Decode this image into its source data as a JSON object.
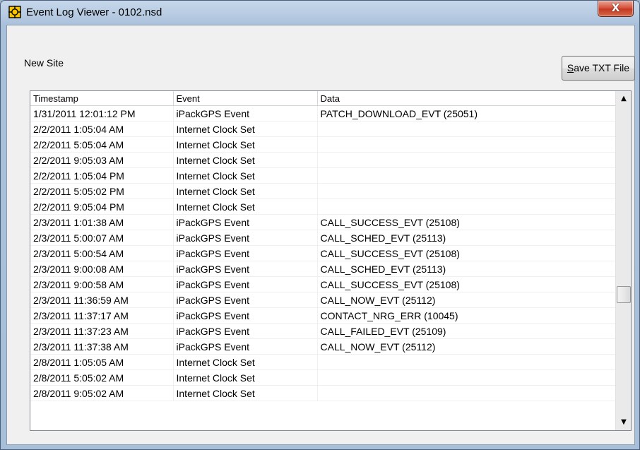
{
  "window": {
    "title": "Event Log Viewer - 0102.nsd",
    "close_label": "X"
  },
  "site_label": "New Site",
  "save_button": {
    "prefix": "S",
    "rest": "ave TXT File"
  },
  "table": {
    "columns": [
      "Timestamp",
      "Event",
      "Data"
    ],
    "rows": [
      [
        "1/31/2011 12:01:12 PM",
        "iPackGPS Event",
        "PATCH_DOWNLOAD_EVT (25051)"
      ],
      [
        "2/2/2011 1:05:04 AM",
        "Internet Clock Set",
        ""
      ],
      [
        "2/2/2011 5:05:04 AM",
        "Internet Clock Set",
        ""
      ],
      [
        "2/2/2011 9:05:03 AM",
        "Internet Clock Set",
        ""
      ],
      [
        "2/2/2011 1:05:04 PM",
        "Internet Clock Set",
        ""
      ],
      [
        "2/2/2011 5:05:02 PM",
        "Internet Clock Set",
        ""
      ],
      [
        "2/2/2011 9:05:04 PM",
        "Internet Clock Set",
        ""
      ],
      [
        "2/3/2011 1:01:38 AM",
        "iPackGPS Event",
        "CALL_SUCCESS_EVT (25108)"
      ],
      [
        "2/3/2011 5:00:07 AM",
        "iPackGPS Event",
        "CALL_SCHED_EVT (25113)"
      ],
      [
        "2/3/2011 5:00:54 AM",
        "iPackGPS Event",
        "CALL_SUCCESS_EVT (25108)"
      ],
      [
        "2/3/2011 9:00:08 AM",
        "iPackGPS Event",
        "CALL_SCHED_EVT (25113)"
      ],
      [
        "2/3/2011 9:00:58 AM",
        "iPackGPS Event",
        "CALL_SUCCESS_EVT (25108)"
      ],
      [
        "2/3/2011 11:36:59 AM",
        "iPackGPS Event",
        "CALL_NOW_EVT (25112)"
      ],
      [
        "2/3/2011 11:37:17 AM",
        "iPackGPS Event",
        "CONTACT_NRG_ERR (10045)"
      ],
      [
        "2/3/2011 11:37:23 AM",
        "iPackGPS Event",
        "CALL_FAILED_EVT (25109)"
      ],
      [
        "2/3/2011 11:37:38 AM",
        "iPackGPS Event",
        "CALL_NOW_EVT (25112)"
      ],
      [
        "2/8/2011 1:05:05 AM",
        "Internet Clock Set",
        ""
      ],
      [
        "2/8/2011 5:05:02 AM",
        "Internet Clock Set",
        ""
      ],
      [
        "2/8/2011 9:05:02 AM",
        "Internet Clock Set",
        ""
      ]
    ]
  },
  "scrollbar": {
    "up_glyph": "▲",
    "down_glyph": "▼"
  }
}
